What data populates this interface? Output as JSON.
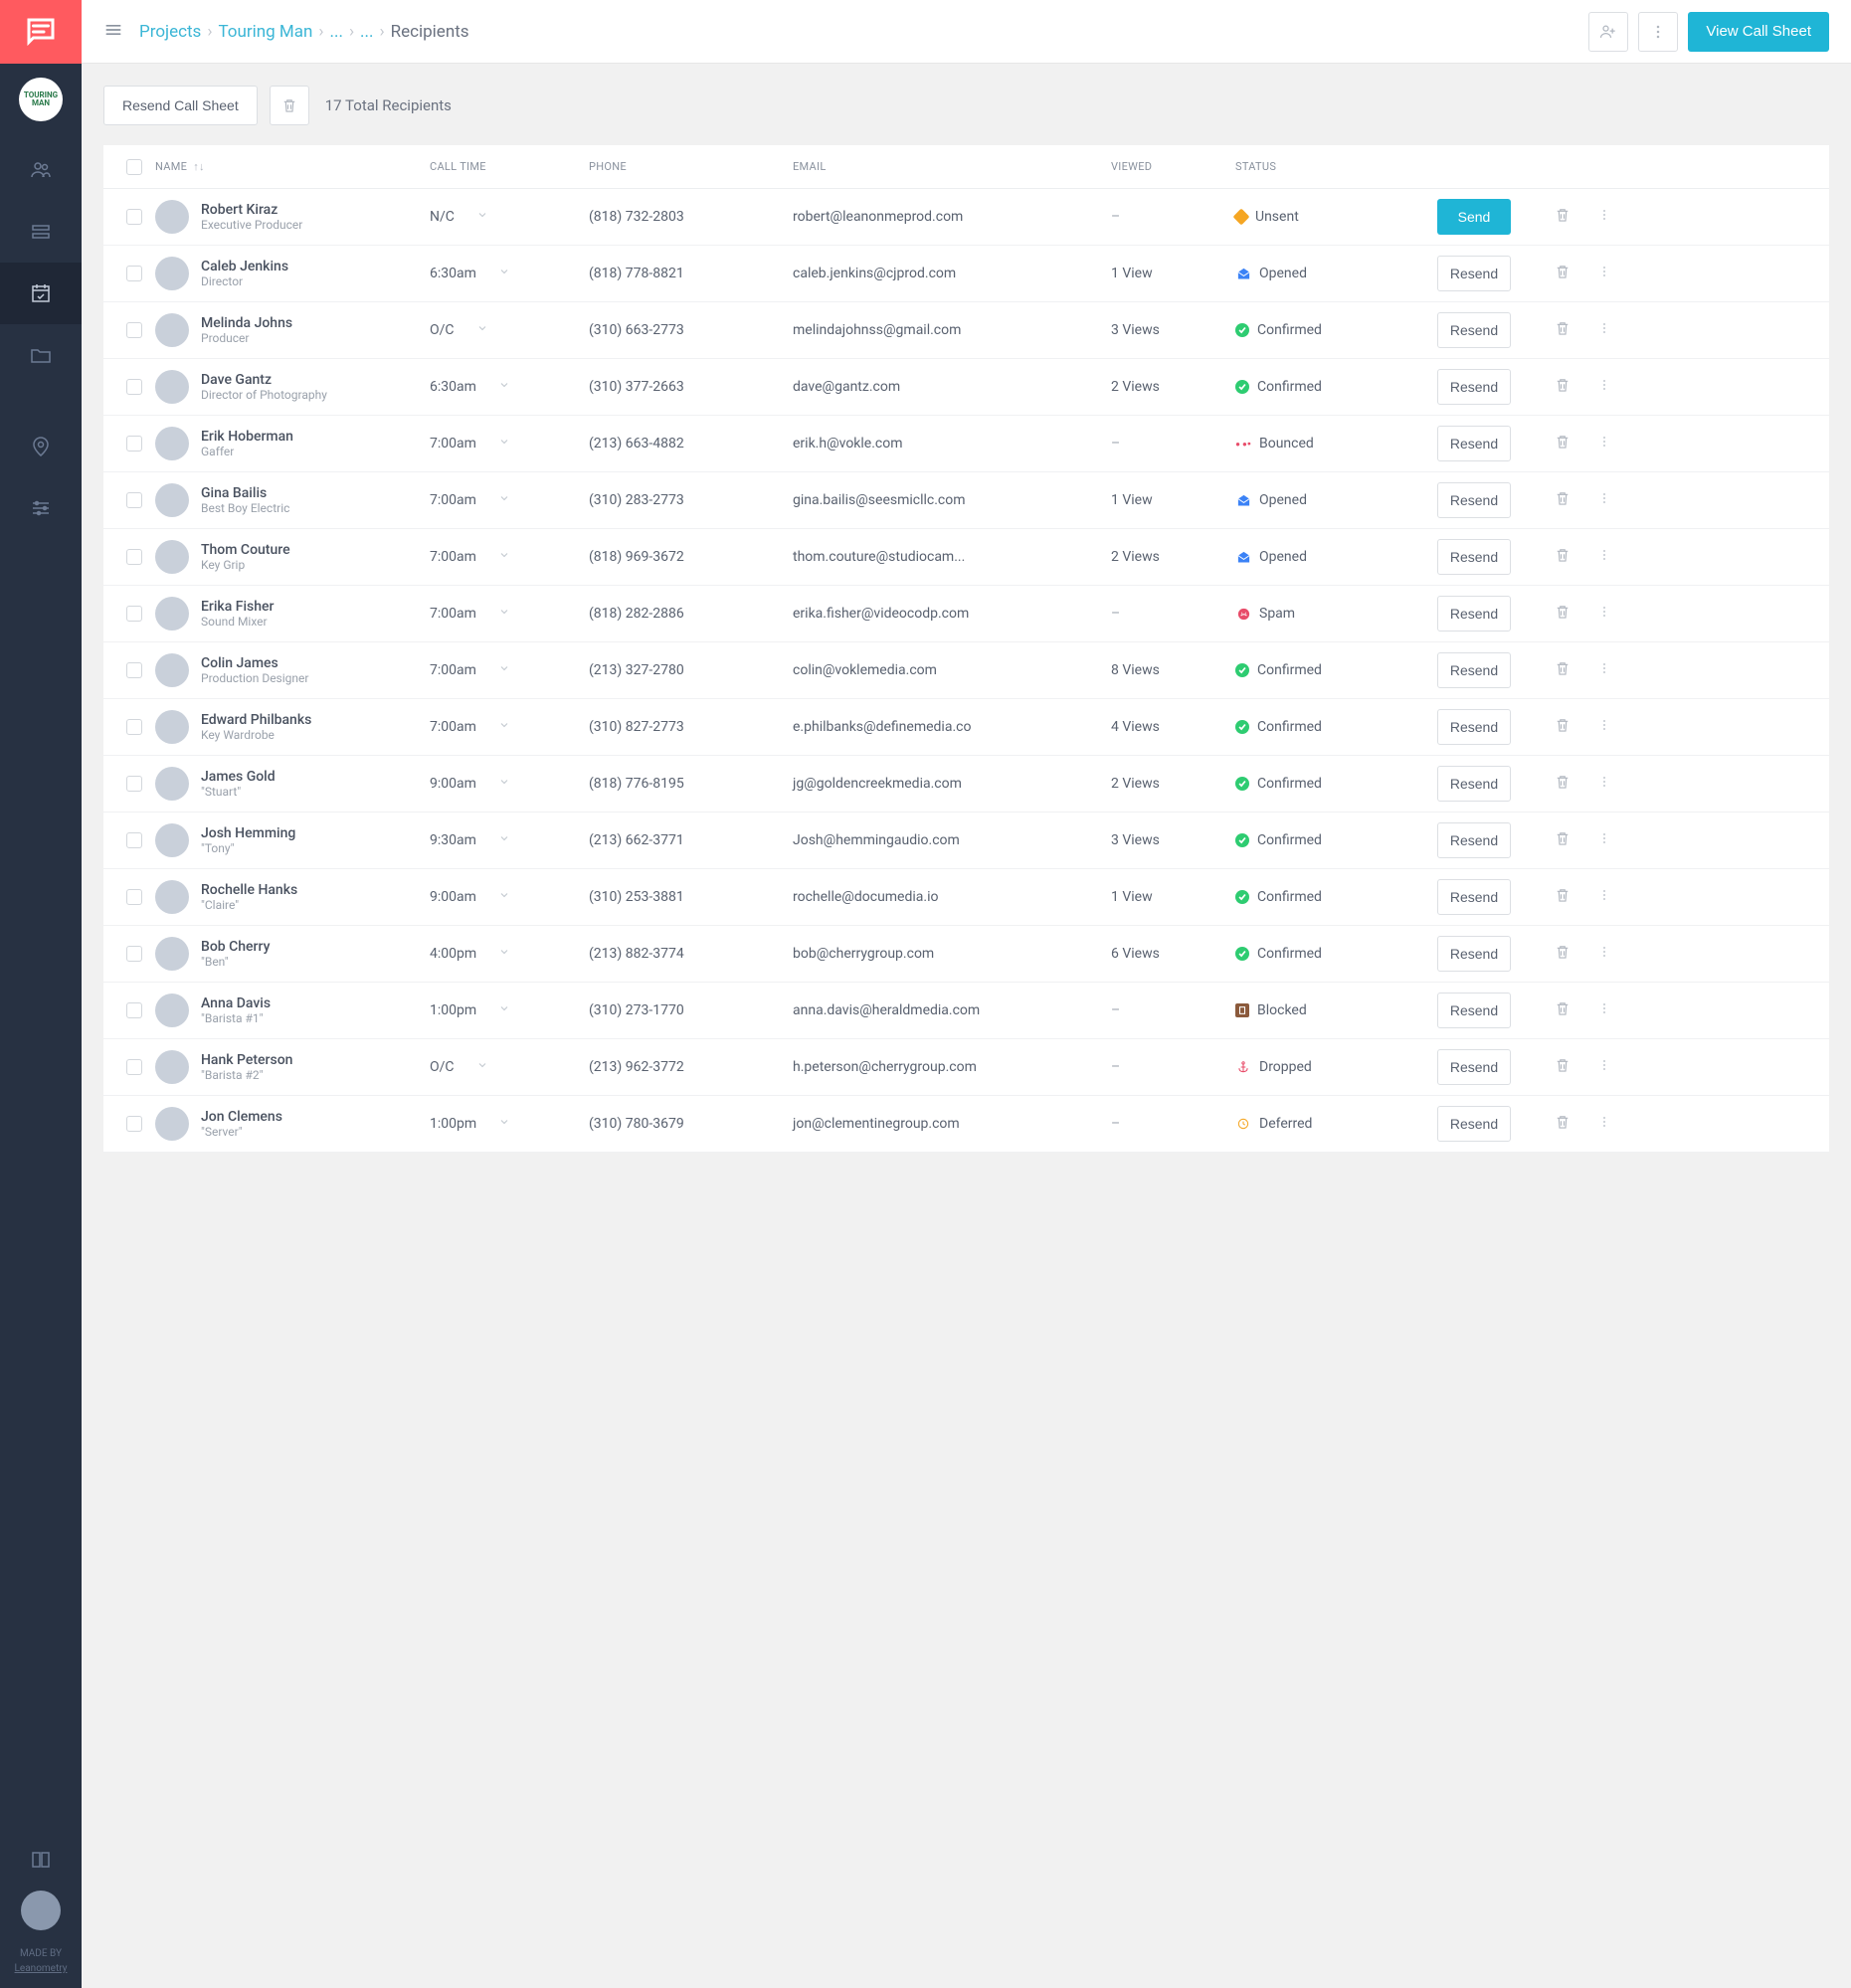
{
  "breadcrumbs": [
    "Projects",
    "Touring Man",
    "...",
    "...",
    "Recipients"
  ],
  "topbar": {
    "view_call_sheet": "View Call Sheet"
  },
  "toolbar": {
    "resend_call_sheet": "Resend Call Sheet",
    "total_recipients": "17 Total Recipients"
  },
  "columns": {
    "name": "NAME",
    "call_time": "CALL TIME",
    "phone": "PHONE",
    "email": "EMAIL",
    "viewed": "VIEWED",
    "status": "STATUS"
  },
  "actions": {
    "send": "Send",
    "resend": "Resend"
  },
  "sidebar": {
    "project_name": "TOURING MAN",
    "madeby_line1": "MADE BY",
    "madeby_line2": "Leanometry"
  },
  "statuses": {
    "unsent": "Unsent",
    "opened": "Opened",
    "confirmed": "Confirmed",
    "bounced": "Bounced",
    "spam": "Spam",
    "blocked": "Blocked",
    "dropped": "Dropped",
    "deferred": "Deferred"
  },
  "recipients": [
    {
      "name": "Robert Kiraz",
      "role": "Executive Producer",
      "call": "N/C",
      "phone": "(818) 732-2803",
      "email": "robert@leanonmeprod.com",
      "viewed": "–",
      "status": "unsent",
      "action": "send"
    },
    {
      "name": "Caleb Jenkins",
      "role": "Director",
      "call": "6:30am",
      "phone": "(818) 778-8821",
      "email": "caleb.jenkins@cjprod.com",
      "viewed": "1 View",
      "status": "opened",
      "action": "resend"
    },
    {
      "name": "Melinda Johns",
      "role": "Producer",
      "call": "O/C",
      "phone": "(310) 663-2773",
      "email": "melindajohnss@gmail.com",
      "viewed": "3 Views",
      "status": "confirmed",
      "action": "resend"
    },
    {
      "name": "Dave Gantz",
      "role": "Director of Photography",
      "call": "6:30am",
      "phone": "(310) 377-2663",
      "email": "dave@gantz.com",
      "viewed": "2 Views",
      "status": "confirmed",
      "action": "resend"
    },
    {
      "name": "Erik Hoberman",
      "role": "Gaffer",
      "call": "7:00am",
      "phone": "(213) 663-4882",
      "email": "erik.h@vokle.com",
      "viewed": "–",
      "status": "bounced",
      "action": "resend"
    },
    {
      "name": "Gina Bailis",
      "role": "Best Boy Electric",
      "call": "7:00am",
      "phone": "(310) 283-2773",
      "email": "gina.bailis@seesmicllc.com",
      "viewed": "1 View",
      "status": "opened",
      "action": "resend"
    },
    {
      "name": "Thom Couture",
      "role": "Key Grip",
      "call": "7:00am",
      "phone": "(818) 969-3672",
      "email": "thom.couture@studiocam...",
      "viewed": "2 Views",
      "status": "opened",
      "action": "resend"
    },
    {
      "name": "Erika Fisher",
      "role": "Sound Mixer",
      "call": "7:00am",
      "phone": "(818) 282-2886",
      "email": "erika.fisher@videocodp.com",
      "viewed": "–",
      "status": "spam",
      "action": "resend"
    },
    {
      "name": "Colin James",
      "role": "Production Designer",
      "call": "7:00am",
      "phone": "(213) 327-2780",
      "email": "colin@voklemedia.com",
      "viewed": "8 Views",
      "status": "confirmed",
      "action": "resend"
    },
    {
      "name": "Edward Philbanks",
      "role": "Key Wardrobe",
      "call": "7:00am",
      "phone": "(310) 827-2773",
      "email": "e.philbanks@definemedia.co",
      "viewed": "4 Views",
      "status": "confirmed",
      "action": "resend"
    },
    {
      "name": "James Gold",
      "role": "\"Stuart\"",
      "call": "9:00am",
      "phone": "(818) 776-8195",
      "email": "jg@goldencreekmedia.com",
      "viewed": "2 Views",
      "status": "confirmed",
      "action": "resend"
    },
    {
      "name": "Josh Hemming",
      "role": "\"Tony\"",
      "call": "9:30am",
      "phone": "(213) 662-3771",
      "email": "Josh@hemmingaudio.com",
      "viewed": "3 Views",
      "status": "confirmed",
      "action": "resend"
    },
    {
      "name": "Rochelle Hanks",
      "role": "\"Claire\"",
      "call": "9:00am",
      "phone": "(310) 253-3881",
      "email": "rochelle@documedia.io",
      "viewed": "1 View",
      "status": "confirmed",
      "action": "resend"
    },
    {
      "name": "Bob Cherry",
      "role": "\"Ben\"",
      "call": "4:00pm",
      "phone": "(213) 882-3774",
      "email": "bob@cherrygroup.com",
      "viewed": "6 Views",
      "status": "confirmed",
      "action": "resend"
    },
    {
      "name": "Anna Davis",
      "role": "\"Barista #1\"",
      "call": "1:00pm",
      "phone": "(310) 273-1770",
      "email": "anna.davis@heraldmedia.com",
      "viewed": "–",
      "status": "blocked",
      "action": "resend"
    },
    {
      "name": "Hank Peterson",
      "role": "\"Barista #2\"",
      "call": "O/C",
      "phone": "(213) 962-3772",
      "email": "h.peterson@cherrygroup.com",
      "viewed": "–",
      "status": "dropped",
      "action": "resend"
    },
    {
      "name": "Jon Clemens",
      "role": "\"Server\"",
      "call": "1:00pm",
      "phone": "(310) 780-3679",
      "email": "jon@clementinegroup.com",
      "viewed": "–",
      "status": "deferred",
      "action": "resend"
    }
  ]
}
